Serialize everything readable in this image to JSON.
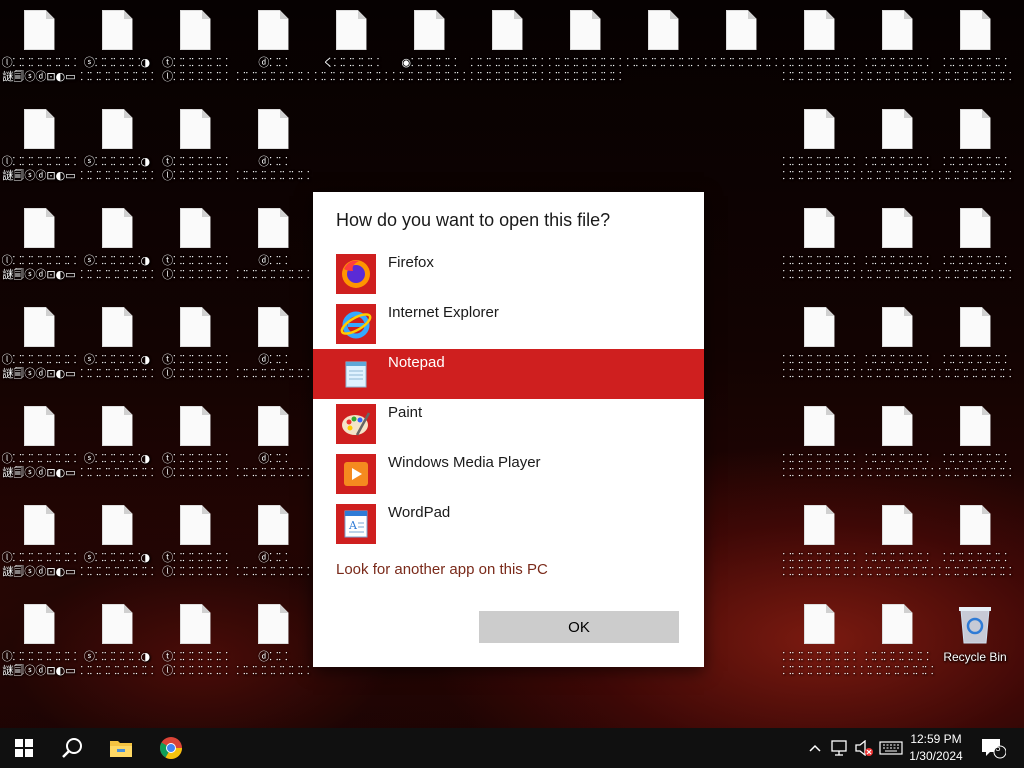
{
  "desktop": {
    "icons": [
      [
        "ⓛ⸬⸬⸬⸬⸬⸬⸬",
        "謎🗐ⓢⓓ⊡◐▭"
      ],
      [
        "ⓢ⸬⸬⸬⸬⸬◑",
        "⸬⸬⸬⸬⸬⸬⸬⸬"
      ],
      [
        "ⓣ⸬⸬⸬⸬⸬⸬",
        "ⓛ⸬⸬⸬⸬⸬⸬"
      ],
      [
        "ⓓ⸬⸬",
        "⸬⸬⸬⸬⸬⸬⸬⸬"
      ],
      [
        "く⸬⸬⸬⸬⸬",
        "⸬⸬⸬⸬⸬⸬⸬⸬"
      ],
      [
        "◉⸬⸬⸬⸬⸬",
        "⸬⸬⸬⸬⸬⸬⸬⸬"
      ],
      [
        "⸬⸬⸬⸬⸬⸬⸬⸬",
        "⸬⸬⸬⸬⸬⸬⸬⸬"
      ],
      [
        "⸬⸬⸬⸬⸬⸬⸬⸬",
        "⸬⸬⸬⸬⸬⸬⸬⸬"
      ],
      [
        "⸬⸬⸬⸬⸬⸬⸬⸬",
        ""
      ],
      [
        "⸬⸬⸬⸬⸬⸬⸬⸬",
        ""
      ],
      [
        "⸬⸬⸬⸬⸬⸬⸬⸬",
        "⸬⸬⸬⸬⸬⸬⸬⸬"
      ],
      [
        "⸬⸬⸬⸬⸬⸬⸬",
        "⸬⸬⸬⸬⸬⸬⸬⸬"
      ],
      [
        "⸬⸬⸬⸬⸬⸬⸬",
        "⸬⸬⸬⸬⸬⸬⸬⸬"
      ]
    ],
    "recycle_bin_label": "Recycle Bin"
  },
  "dialog": {
    "title": "How do you want to open this file?",
    "apps": [
      {
        "name": "Firefox",
        "icon": "firefox-icon"
      },
      {
        "name": "Internet Explorer",
        "icon": "internet-explorer-icon"
      },
      {
        "name": "Notepad",
        "icon": "notepad-icon"
      },
      {
        "name": "Paint",
        "icon": "paint-icon"
      },
      {
        "name": "Windows Media Player",
        "icon": "windows-media-player-icon"
      },
      {
        "name": "WordPad",
        "icon": "wordpad-icon"
      }
    ],
    "selected_app": "Notepad",
    "look_link": "Look for another app on this PC",
    "ok_label": "OK",
    "accent_color": "#cf1f1f"
  },
  "taskbar": {
    "time": "12:59 PM",
    "date": "1/30/2024",
    "notification_count": "5",
    "pinned": [
      "windows-start-icon",
      "search-icon",
      "file-explorer-icon",
      "chrome-icon"
    ]
  }
}
